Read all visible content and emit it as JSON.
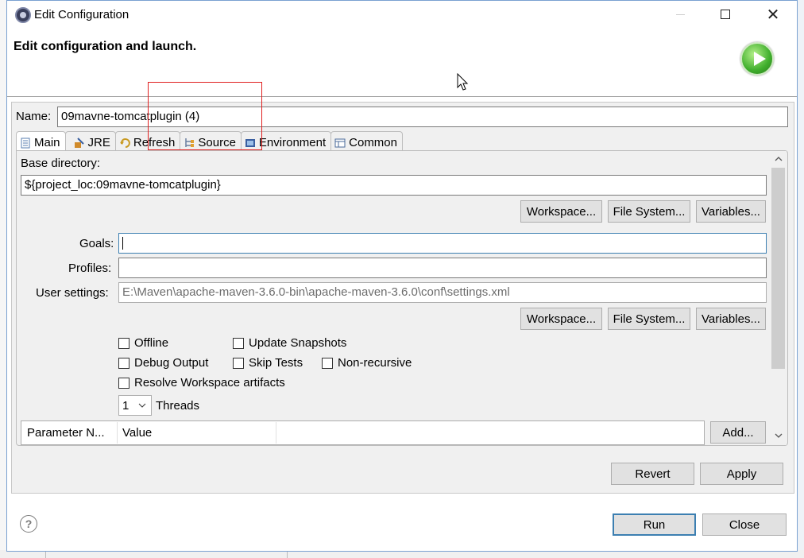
{
  "window": {
    "title": "Edit Configuration",
    "controls": {
      "minimize": "—",
      "maximize": "☐",
      "close": "✕"
    }
  },
  "header": {
    "title": "Edit configuration and launch.",
    "icon": "launch-run-icon"
  },
  "name": {
    "label": "Name:",
    "value": "09mavne-tomcatplugin (4)"
  },
  "tabs": [
    {
      "label": "Main",
      "icon": "main-tab-icon",
      "selected": true
    },
    {
      "label": "JRE",
      "icon": "jre-icon"
    },
    {
      "label": "Refresh",
      "icon": "refresh-icon"
    },
    {
      "label": "Source",
      "icon": "source-icon"
    },
    {
      "label": "Environment",
      "icon": "environment-icon"
    },
    {
      "label": "Common",
      "icon": "common-icon"
    }
  ],
  "main": {
    "base_directory_label": "Base directory:",
    "base_directory_value": "${project_loc:09mavne-tomcatplugin}",
    "base_buttons": [
      "Workspace...",
      "File System...",
      "Variables..."
    ],
    "goals_label": "Goals:",
    "goals_value": "",
    "profiles_label": "Profiles:",
    "profiles_value": "",
    "user_settings_label": "User settings:",
    "user_settings_value": "E:\\Maven\\apache-maven-3.6.0-bin\\apache-maven-3.6.0\\conf\\settings.xml",
    "settings_buttons": [
      "Workspace...",
      "File System...",
      "Variables..."
    ],
    "checkboxes": {
      "offline": "Offline",
      "update_snapshots": "Update Snapshots",
      "debug_output": "Debug Output",
      "skip_tests": "Skip Tests",
      "non_recursive": "Non-recursive",
      "resolve_workspace": "Resolve Workspace artifacts"
    },
    "threads_value": "1",
    "threads_label": "Threads",
    "param_table": {
      "columns": [
        "Parameter N...",
        "Value"
      ],
      "add_button": "Add..."
    }
  },
  "footer": {
    "revert": "Revert",
    "apply": "Apply",
    "run": "Run",
    "close": "Close",
    "help": "?"
  }
}
